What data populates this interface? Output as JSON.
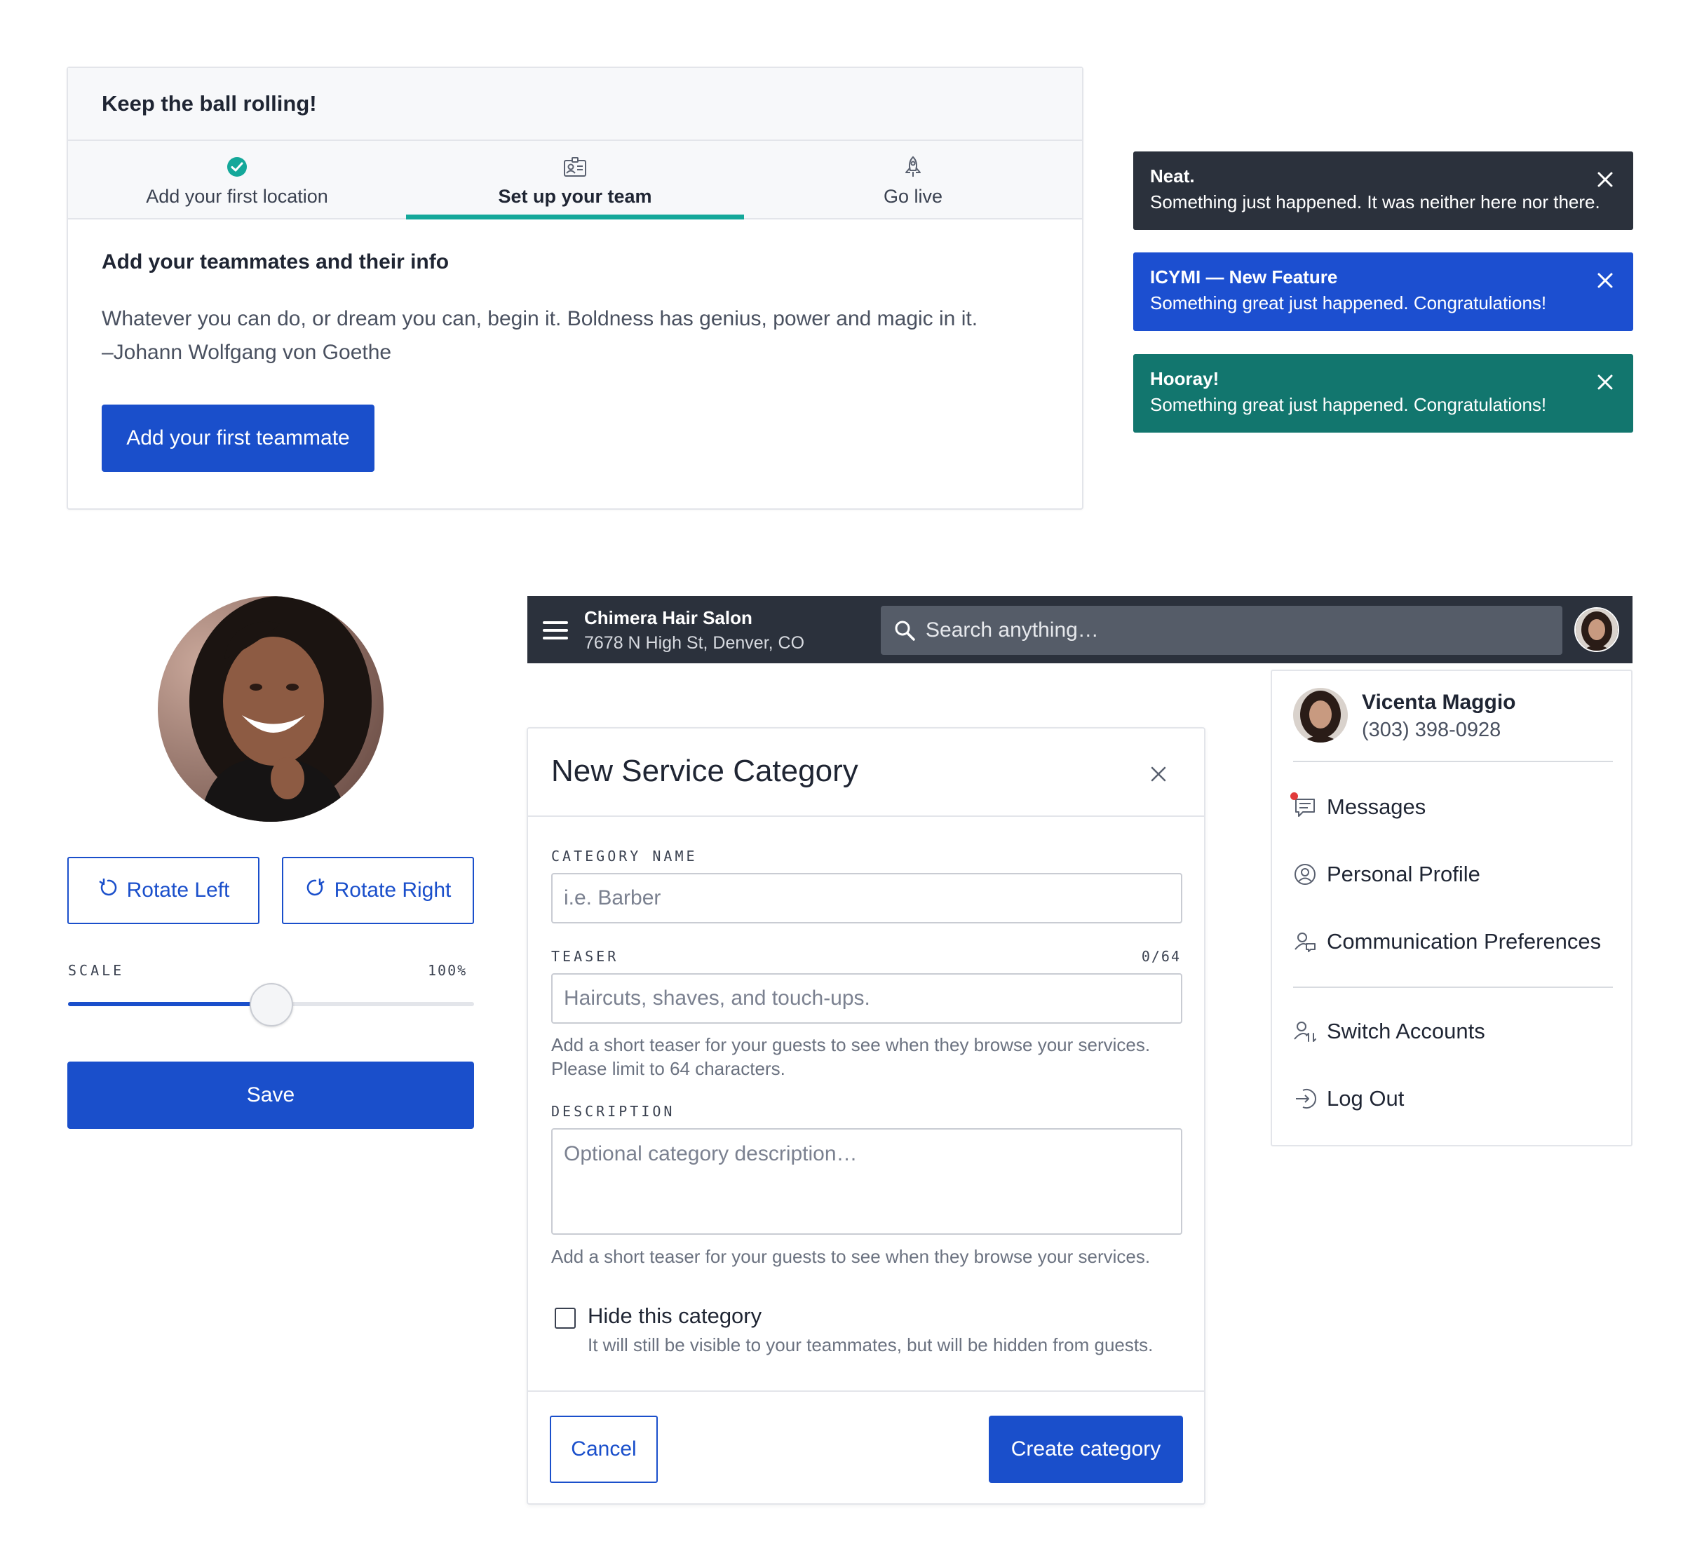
{
  "onboarding": {
    "title": "Keep the ball rolling!",
    "steps": [
      {
        "label": "Add your first location",
        "icon": "check-circle-icon",
        "state": "done"
      },
      {
        "label": "Set up your team",
        "icon": "id-card-icon",
        "state": "active"
      },
      {
        "label": "Go live",
        "icon": "rocket-icon",
        "state": "todo"
      }
    ],
    "heading": "Add your teammates and their info",
    "quote_line1": "Whatever you can do, or dream you can, begin it. Boldness has genius, power and magic in it.",
    "quote_line2": "–Johann Wolfgang von Goethe",
    "cta_label": "Add your first teammate"
  },
  "toasts": [
    {
      "title": "Neat.",
      "message": "Something just happened. It was neither here nor there.",
      "color": "#2b313c"
    },
    {
      "title": "ICYMI — New Feature",
      "message": "Something great just happened. Congratulations!",
      "color": "#1c4fd0"
    },
    {
      "title": "Hooray!",
      "message": "Something great just happened. Congratulations!",
      "color": "#12766e"
    }
  ],
  "avatar_editor": {
    "rotate_left_label": "Rotate Left",
    "rotate_right_label": "Rotate Right",
    "scale_label": "SCALE",
    "scale_value": "100%",
    "scale_fraction": 0.5,
    "save_label": "Save"
  },
  "topbar": {
    "business_name": "Chimera Hair Salon",
    "business_address": "7678 N High St, Denver, CO",
    "search_placeholder": "Search anything…"
  },
  "modal": {
    "title": "New Service Category",
    "category_name_label": "CATEGORY NAME",
    "category_name_placeholder": "i.e. Barber",
    "teaser_label": "TEASER",
    "teaser_count": "0/64",
    "teaser_placeholder": "Haircuts, shaves, and touch-ups.",
    "teaser_help_1": "Add a short teaser for your guests to see when they browse your services.",
    "teaser_help_2": "Please limit to 64 characters.",
    "description_label": "DESCRIPTION",
    "description_placeholder": "Optional category description…",
    "description_help": "Add a short teaser for your guests to see when they browse your services.",
    "hide_label": "Hide this category",
    "hide_help": "It will still be visible to your teammates, but will be hidden from guests.",
    "hide_checked": false,
    "cancel_label": "Cancel",
    "create_label": "Create category"
  },
  "account_menu": {
    "name": "Vicenta Maggio",
    "phone": "(303) 398-0928",
    "items": [
      {
        "label": "Messages",
        "icon": "messages-icon",
        "unread": true
      },
      {
        "label": "Personal Profile",
        "icon": "profile-icon"
      },
      {
        "label": "Communication Preferences",
        "icon": "communication-icon"
      },
      {
        "label": "Switch Accounts",
        "icon": "switch-accounts-icon"
      },
      {
        "label": "Log Out",
        "icon": "logout-icon"
      }
    ]
  },
  "colors": {
    "primary": "#1a4fcb",
    "teal": "#14a89a",
    "dark": "#2b313c"
  }
}
